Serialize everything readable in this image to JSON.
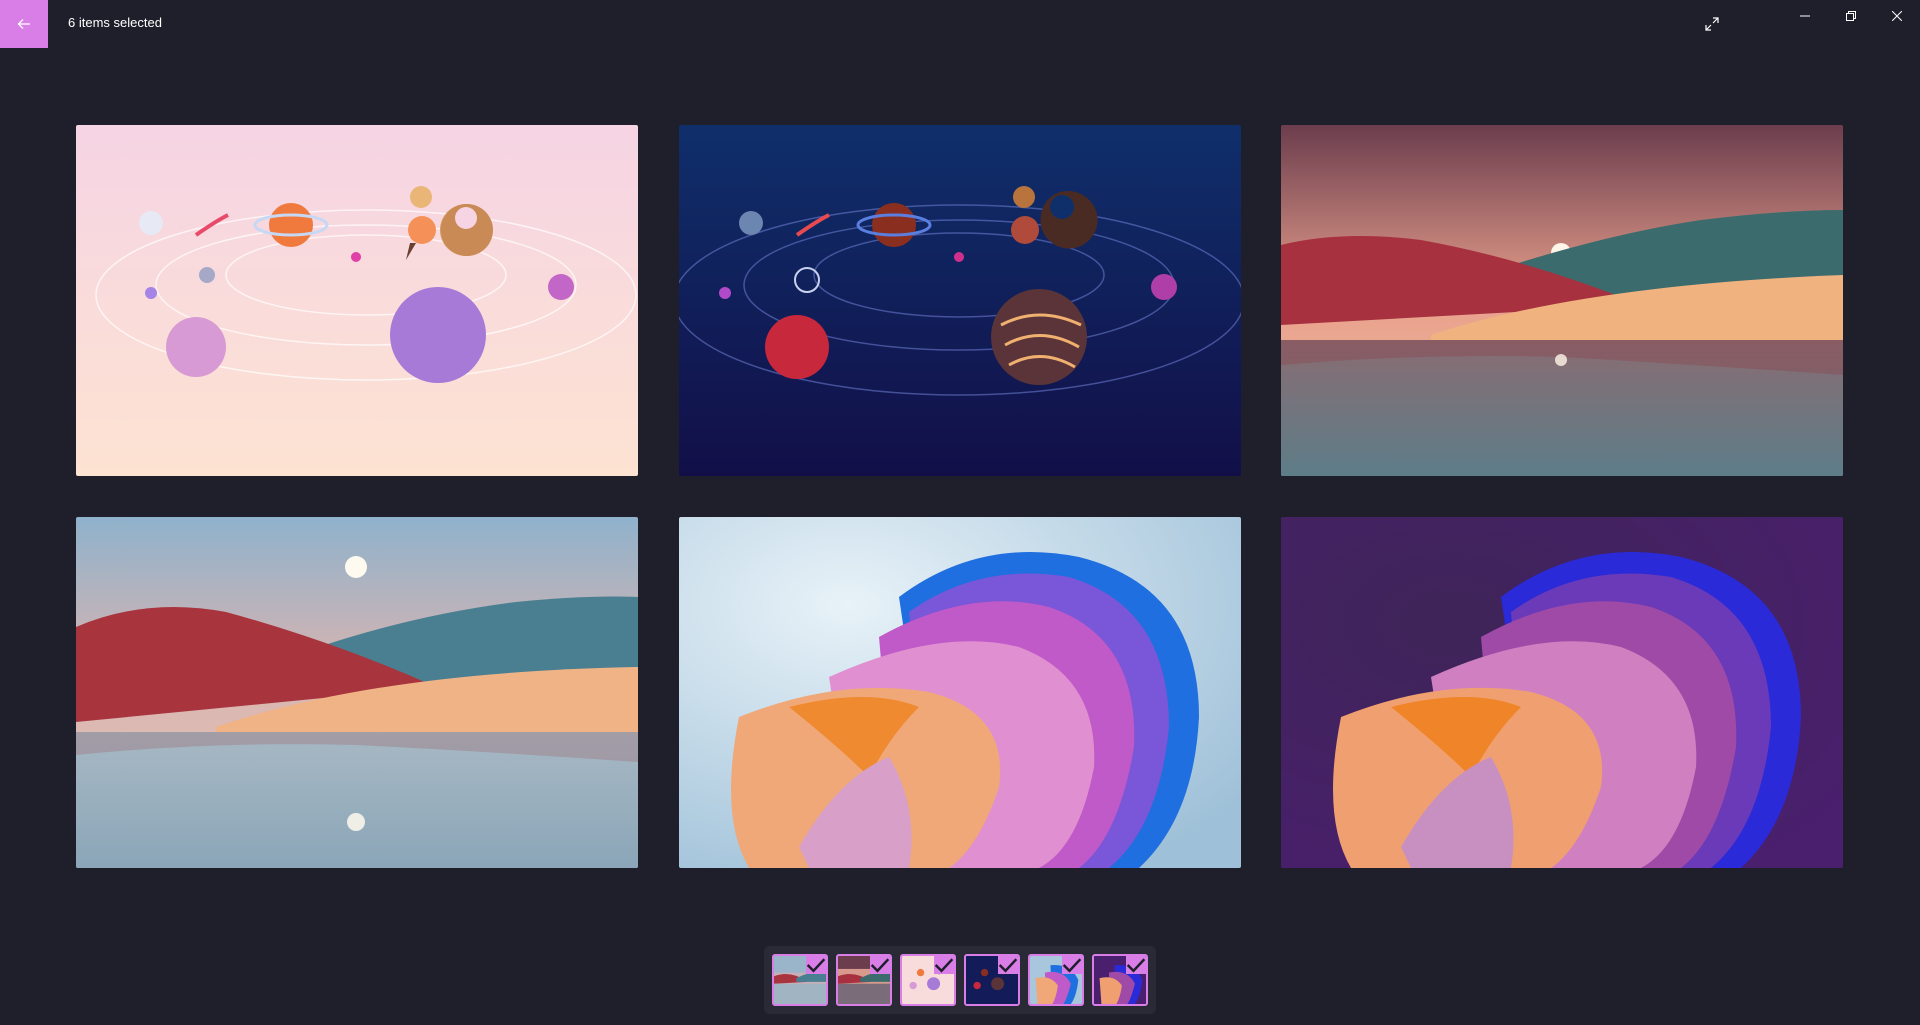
{
  "header": {
    "title": "6 items selected",
    "accent_color": "#d87ee6",
    "back_icon": "arrow-left-icon",
    "expand_icon": "expand-icon"
  },
  "window_controls": {
    "minimize_icon": "minimize-icon",
    "restore_icon": "restore-icon",
    "close_icon": "close-icon"
  },
  "filmstrip": {
    "thumbnails": [
      {
        "selected": true
      },
      {
        "selected": true
      },
      {
        "selected": true
      },
      {
        "selected": true
      },
      {
        "selected": true
      },
      {
        "selected": true
      }
    ]
  }
}
